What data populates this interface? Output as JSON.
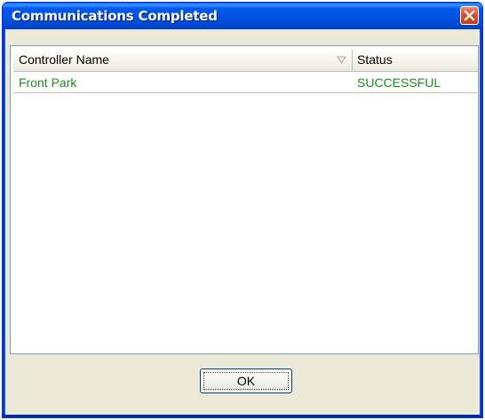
{
  "window": {
    "title": "Communications Completed"
  },
  "icons": {
    "close": "close-icon",
    "sort": "sort-descending-icon"
  },
  "colors": {
    "titlebar": "#0054e3",
    "row_text": "#1e8a1e",
    "close_button": "#d6512b"
  },
  "table": {
    "columns": [
      "Controller Name",
      "Status"
    ],
    "sort_column": "Controller Name",
    "rows": [
      {
        "controller_name": "Front Park",
        "status": "SUCCESSFUL"
      }
    ]
  },
  "footer": {
    "ok_label": "OK"
  }
}
